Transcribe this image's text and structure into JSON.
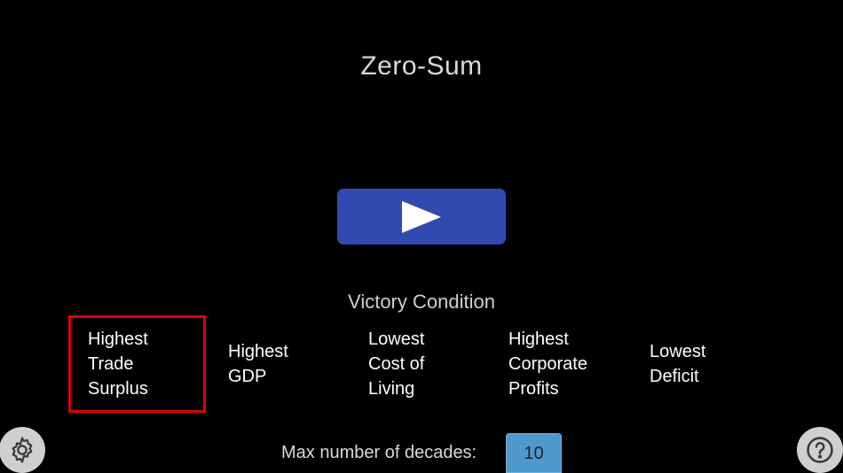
{
  "title": "Zero-Sum",
  "play_button": {
    "icon": "play-icon"
  },
  "victory": {
    "label": "Victory Condition",
    "options": [
      {
        "label": "Highest\nTrade\nSurplus",
        "selected": true
      },
      {
        "label": "Highest\nGDP",
        "selected": false
      },
      {
        "label": "Lowest\nCost of\nLiving",
        "selected": false
      },
      {
        "label": "Highest\nCorporate\nProfits",
        "selected": false
      },
      {
        "label": "Lowest\nDeficit",
        "selected": false
      }
    ],
    "selected_color": "#e00000"
  },
  "decades": {
    "label": "Max number of decades:",
    "value": "10"
  },
  "settings_button": {
    "icon": "gear-icon"
  },
  "help_button": {
    "icon": "question-mark-icon"
  },
  "colors": {
    "background": "#000000",
    "play_button": "#3149b1",
    "input": "#4f98cc"
  }
}
